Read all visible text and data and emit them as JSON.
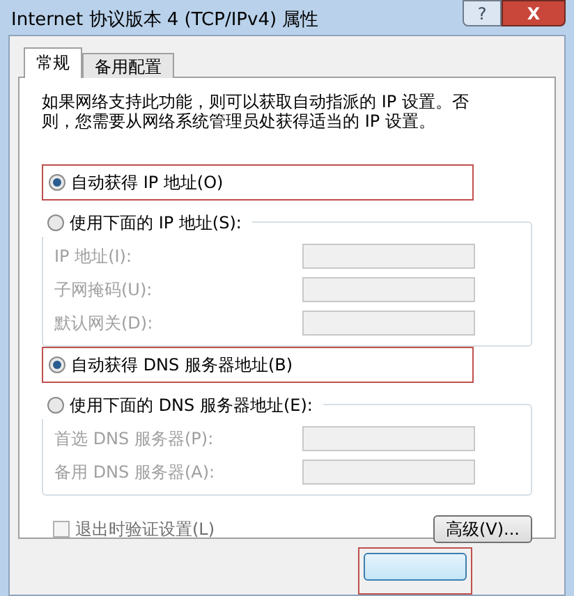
{
  "window": {
    "title": "Internet 协议版本 4 (TCP/IPv4) 属性",
    "help_button": "?",
    "close_button": "X"
  },
  "tabs": [
    {
      "label": "常规",
      "selected": true
    },
    {
      "label": "备用配置",
      "selected": false
    }
  ],
  "intro": "如果网络支持此功能，则可以获取自动指派的 IP 设置。否则，您需要从网络系统管理员处获得适当的 IP 设置。",
  "ip_section": {
    "auto": {
      "label": "自动获得 IP 地址(O)",
      "selected": true,
      "highlighted": true
    },
    "manual": {
      "label": "使用下面的 IP 地址(S):",
      "selected": false
    },
    "fields": [
      {
        "label": "IP 地址(I):",
        "disabled": true
      },
      {
        "label": "子网掩码(U):",
        "disabled": true
      },
      {
        "label": "默认网关(D):",
        "disabled": true
      }
    ]
  },
  "dns_section": {
    "auto": {
      "label": "自动获得 DNS 服务器地址(B)",
      "selected": true,
      "highlighted": true
    },
    "manual": {
      "label": "使用下面的 DNS 服务器地址(E):",
      "selected": false
    },
    "fields": [
      {
        "label": "首选 DNS 服务器(P):",
        "disabled": true
      },
      {
        "label": "备用 DNS 服务器(A):",
        "disabled": true
      }
    ]
  },
  "validate": {
    "label": "退出时验证设置(L)",
    "checked": false,
    "disabled": true
  },
  "advanced_button": "高级(V)...",
  "bottom_button": {
    "highlighted": true
  }
}
